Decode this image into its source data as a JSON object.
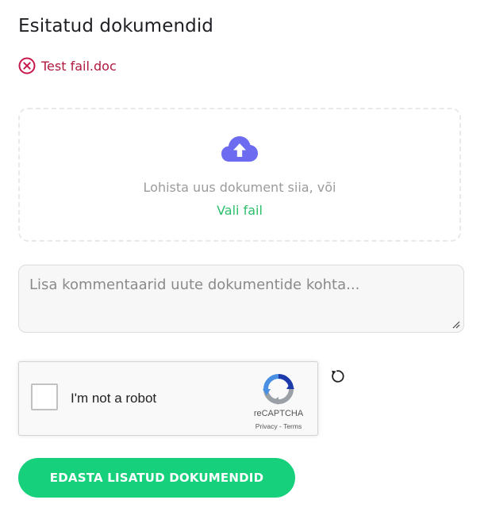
{
  "section": {
    "title": "Esitatud dokumendid"
  },
  "submitted_files": [
    {
      "name": "Test fail.doc",
      "icon": "remove-circle-icon",
      "color": "#b0193f"
    }
  ],
  "dropzone": {
    "icon": "cloud-upload-icon",
    "icon_color": "#6d6bf0",
    "text": "Lohista uus dokument siia, või",
    "choose_file_label": "Vali fail",
    "link_color": "#2bbf6a"
  },
  "comment": {
    "placeholder": "Lisa kommentaarid uute dokumentide kohta...",
    "value": ""
  },
  "recaptcha": {
    "checkbox_label": "I'm not a robot",
    "checked": false,
    "brand": "reCAPTCHA",
    "privacy_label": "Privacy",
    "separator": " - ",
    "terms_label": "Terms"
  },
  "refresh": {
    "icon": "refresh-icon"
  },
  "submit": {
    "label": "EDASTA LISATUD DOKUMENDID",
    "color": "#16d07b"
  }
}
